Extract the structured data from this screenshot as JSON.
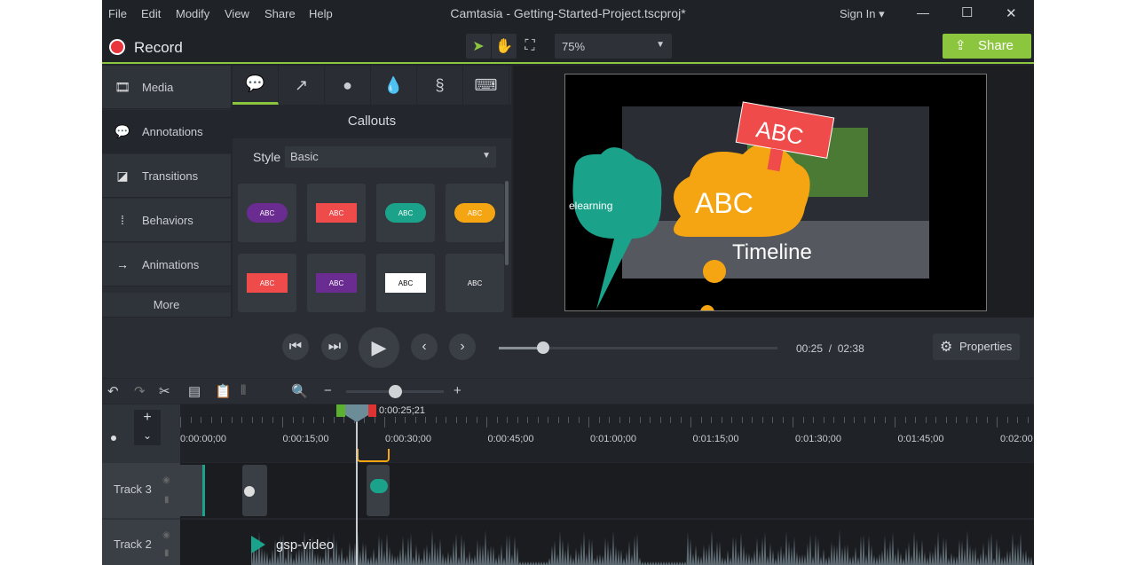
{
  "window": {
    "title": "Camtasia - Getting-Started-Project.tscproj*",
    "sign_in": "Sign In ▾",
    "minimize": "—",
    "maximize": "☐",
    "close": "✕"
  },
  "menu": [
    "File",
    "Edit",
    "Modify",
    "View",
    "Share",
    "Help"
  ],
  "toolbar": {
    "record_label": "Record",
    "zoom_value": "75%",
    "share_label": "Share",
    "accent": "#8cc63f",
    "record_color": "#e8363c"
  },
  "sidebar": {
    "items": [
      {
        "label": "Media",
        "icon": "film-icon"
      },
      {
        "label": "Annotations",
        "icon": "callout-icon"
      },
      {
        "label": "Transitions",
        "icon": "transition-icon"
      },
      {
        "label": "Behaviors",
        "icon": "behaviors-icon"
      },
      {
        "label": "Animations",
        "icon": "animation-arrow-icon"
      }
    ],
    "more_label": "More"
  },
  "panel": {
    "tabs": [
      "callout-icon",
      "arrow-icon",
      "shape-icon",
      "blur-drop-icon",
      "sketch-motion-icon",
      "keyboard-icon"
    ],
    "header": "Callouts",
    "style_label": "Style",
    "style_value": "Basic",
    "callout_text": "ABC"
  },
  "preview": {
    "cloud_green_text": "elearning",
    "cloud_yellow_text": "ABC",
    "sign_text": "ABC",
    "timeline_text": "Timeline"
  },
  "playback": {
    "current": "00:25",
    "separator": "/",
    "duration": "02:38",
    "progress": 0.16,
    "properties_label": "Properties"
  },
  "timeline": {
    "playhead_time": "0:00:25;21",
    "ruler_labels": [
      "0:00:00;00",
      "0:00:15;00",
      "0:00:30;00",
      "0:00:45;00",
      "0:01:00;00",
      "0:01:15;00",
      "0:01:30;00",
      "0:01:45;00",
      "0:02:00"
    ],
    "tracks": [
      {
        "name": "Track 3"
      },
      {
        "name": "Track 2",
        "clip": "gsp-video"
      }
    ],
    "zoom_level": 0.5
  }
}
